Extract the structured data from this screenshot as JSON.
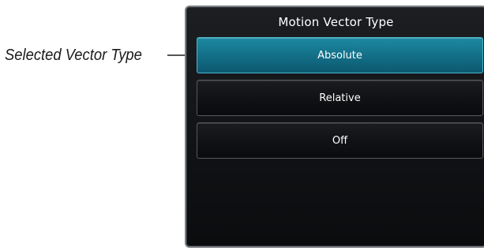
{
  "callout": {
    "label": "Selected Vector Type"
  },
  "panel": {
    "title": "Motion Vector Type",
    "options": [
      {
        "label": "Absolute",
        "selected": true
      },
      {
        "label": "Relative",
        "selected": false
      },
      {
        "label": "Off",
        "selected": false
      }
    ]
  },
  "colors": {
    "selected_fill": "#137088",
    "selected_border": "#4fb6cc",
    "panel_border": "#7c7f84"
  }
}
